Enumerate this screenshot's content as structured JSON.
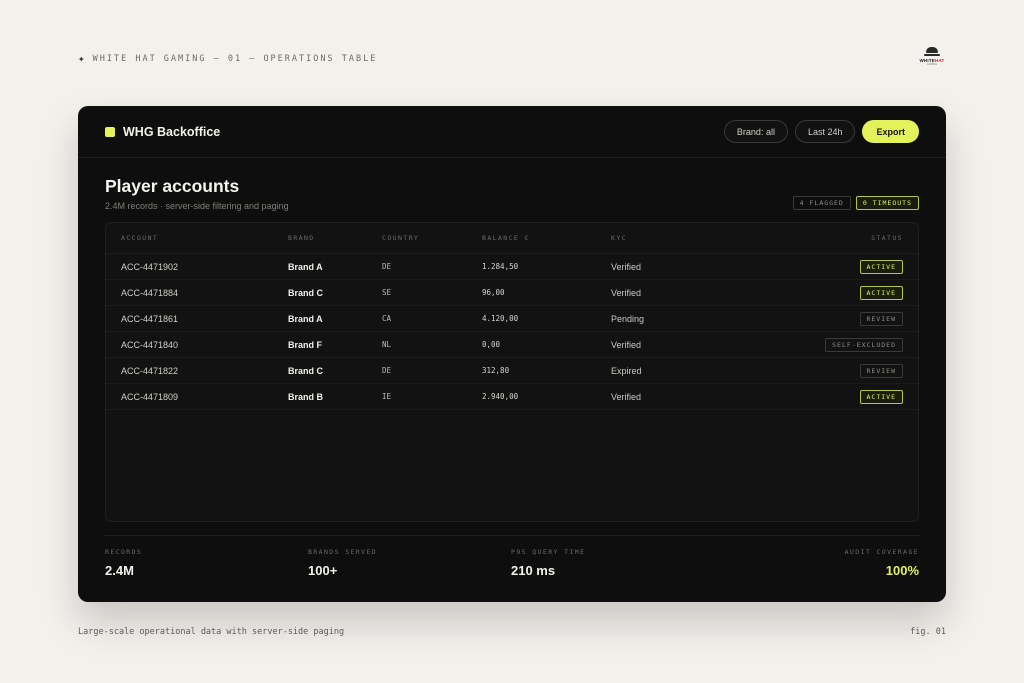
{
  "page": {
    "top_caption": "WHITE HAT GAMING — 01 — OPERATIONS TABLE",
    "logo": {
      "word_left": "WHITE",
      "word_right": "HAT",
      "sub": "GAMING"
    },
    "bottom_caption": "Large-scale operational data with server-side paging",
    "fig_label": "fig. 01"
  },
  "app": {
    "brand_name": "WHG Backoffice",
    "accent_color": "#e3f25a",
    "filters": {
      "brand": "Brand: all",
      "range": "Last 24h"
    },
    "export_label": "Export"
  },
  "main": {
    "title": "Player accounts",
    "subtitle": "2.4M records · server-side filtering and paging",
    "badges": {
      "flagged": "4 FLAGGED",
      "timeouts": "0 TIMEOUTS"
    }
  },
  "table": {
    "headers": [
      "ACCOUNT",
      "BRAND",
      "COUNTRY",
      "BALANCE €",
      "KYC",
      "STATUS"
    ],
    "rows": [
      {
        "account": "ACC-4471902",
        "brand": "Brand A",
        "country": "DE",
        "balance": "1.284,50",
        "kyc": "Verified",
        "status": "ACTIVE"
      },
      {
        "account": "ACC-4471884",
        "brand": "Brand C",
        "country": "SE",
        "balance": "96,00",
        "kyc": "Verified",
        "status": "ACTIVE"
      },
      {
        "account": "ACC-4471861",
        "brand": "Brand A",
        "country": "CA",
        "balance": "4.120,00",
        "kyc": "Pending",
        "status": "REVIEW"
      },
      {
        "account": "ACC-4471840",
        "brand": "Brand F",
        "country": "NL",
        "balance": "0,00",
        "kyc": "Verified",
        "status": "SELF-EXCLUDED"
      },
      {
        "account": "ACC-4471822",
        "brand": "Brand C",
        "country": "DE",
        "balance": "312,80",
        "kyc": "Expired",
        "status": "REVIEW"
      },
      {
        "account": "ACC-4471809",
        "brand": "Brand B",
        "country": "IE",
        "balance": "2.940,00",
        "kyc": "Verified",
        "status": "ACTIVE"
      }
    ]
  },
  "stats": [
    {
      "label": "RECORDS",
      "value": "2.4M"
    },
    {
      "label": "BRANDS SERVED",
      "value": "100+"
    },
    {
      "label": "P95 QUERY TIME",
      "value": "210 ms"
    },
    {
      "label": "AUDIT COVERAGE",
      "value": "100%"
    }
  ]
}
